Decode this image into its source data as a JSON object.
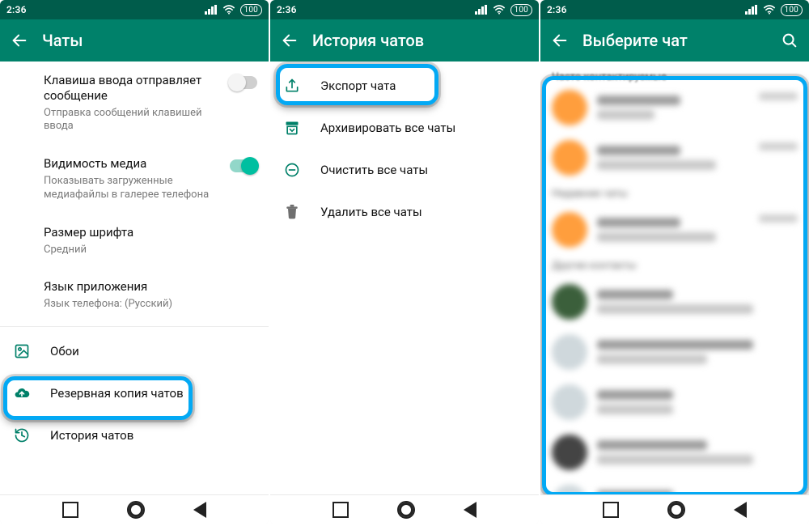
{
  "status": {
    "time": "2:36",
    "battery": "100"
  },
  "panel1": {
    "title": "Чаты",
    "item_enter": {
      "primary": "Клавиша ввода отправляет сообщение",
      "secondary": "Отправка сообщений клавишей ввода"
    },
    "item_media": {
      "primary": "Видимость медиа",
      "secondary": "Показывать загруженные медиафайлы в галерее телефона"
    },
    "item_font": {
      "primary": "Размер шрифта",
      "secondary": "Средний"
    },
    "item_lang": {
      "primary": "Язык приложения",
      "secondary": "Язык телефона: (Русский)"
    },
    "item_wall": {
      "label": "Обои"
    },
    "item_backup": {
      "label": "Резервная копия чатов"
    },
    "item_hist": {
      "label": "История чатов"
    }
  },
  "panel2": {
    "title": "История чатов",
    "item_export": {
      "label": "Экспорт чата"
    },
    "item_archive": {
      "label": "Архивировать все чаты"
    },
    "item_clear": {
      "label": "Очистить все чаты"
    },
    "item_delete": {
      "label": "Удалить все чаты"
    }
  },
  "panel3": {
    "title": "Выберите чат",
    "sec_frequent": "Часто контактируемые",
    "sec_recent": "Недавние чаты",
    "sec_other": "Другие контакты"
  }
}
